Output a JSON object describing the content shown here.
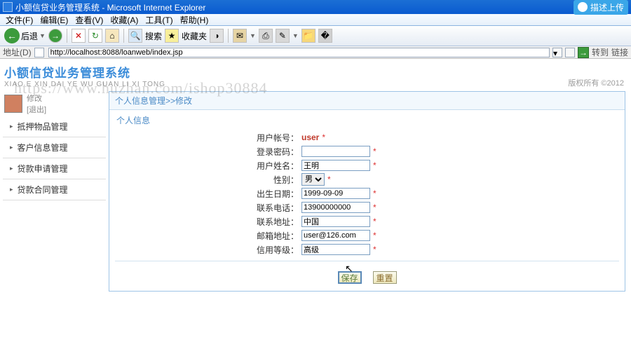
{
  "window": {
    "title": "小额信贷业务管理系统 - Microsoft Internet Explorer",
    "upload_label": "描述上传"
  },
  "menubar": {
    "file": "文件(F)",
    "edit": "编辑(E)",
    "view": "查看(V)",
    "favorites": "收藏(A)",
    "tools": "工具(T)",
    "help": "帮助(H)"
  },
  "toolbar": {
    "back": "后退",
    "search": "搜索",
    "favorites": "收藏夹"
  },
  "addressbar": {
    "label": "地址(D)",
    "url": "http://localhost:8088/loanweb/index.jsp",
    "go": "转到",
    "links": "链接"
  },
  "app": {
    "title_cn": "小额信贷业务管理系统",
    "title_pinyin": "XIAO E XIN DAI YE WU GUAN LI XI TONG",
    "copyright": "版权所有  ©2012",
    "watermark": "https://www.huzhan.com/ishop30884"
  },
  "sidebar": {
    "user_label": "修改",
    "logout": "[退出]",
    "items": [
      {
        "label": "抵押物品管理"
      },
      {
        "label": "客户信息管理"
      },
      {
        "label": "贷款申请管理"
      },
      {
        "label": "贷款合同管理"
      }
    ]
  },
  "breadcrumb": {
    "text": "个人信息管理>>修改"
  },
  "section": {
    "title": "个人信息"
  },
  "form": {
    "account_label": "用户帐号：",
    "account_value": "user",
    "password_label": "登录密码：",
    "name_label": "用户姓名：",
    "name_value": "王明",
    "gender_label": "性别：",
    "gender_value": "男",
    "birth_label": "出生日期：",
    "birth_value": "1999-09-09",
    "phone_label": "联系电话：",
    "phone_value": "13900000000",
    "address_label": "联系地址：",
    "address_value": "中国",
    "email_label": "邮箱地址：",
    "email_value": "user@126.com",
    "credit_label": "信用等级：",
    "credit_value": "高级",
    "required_mark": "*"
  },
  "buttons": {
    "save": "保存",
    "reset": "重置"
  }
}
